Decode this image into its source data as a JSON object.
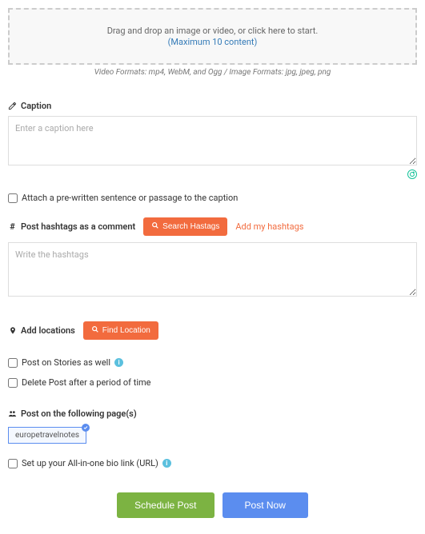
{
  "dropzone": {
    "text": "Drag and drop an image or video, or click here to start.",
    "limit": "(Maximum 10 content)"
  },
  "formats": {
    "video_prefix": "Video Formats: mp4, WebM, and Ogg",
    "sep": " / ",
    "image_prefix": "Image Formats: jpg, jpeg, png"
  },
  "caption": {
    "label": "Caption",
    "placeholder": "Enter a caption here"
  },
  "attach_sentence": {
    "label": "Attach a pre-written sentence or passage to the caption"
  },
  "hashtags": {
    "label": "Post hashtags as a comment",
    "search_btn": "Search Hastags",
    "add_link": "Add my hashtags",
    "placeholder": "Write the hashtags"
  },
  "locations": {
    "label": "Add locations",
    "find_btn": "Find Location"
  },
  "stories": {
    "label": "Post on Stories as well"
  },
  "delete_after": {
    "label": "Delete Post after a period of time"
  },
  "pages": {
    "label": "Post on the following page(s)",
    "chip": "europetravelnotes"
  },
  "bio_link": {
    "label": "Set up your All-in-one bio link (URL)"
  },
  "actions": {
    "schedule": "Schedule Post",
    "now": "Post Now"
  }
}
